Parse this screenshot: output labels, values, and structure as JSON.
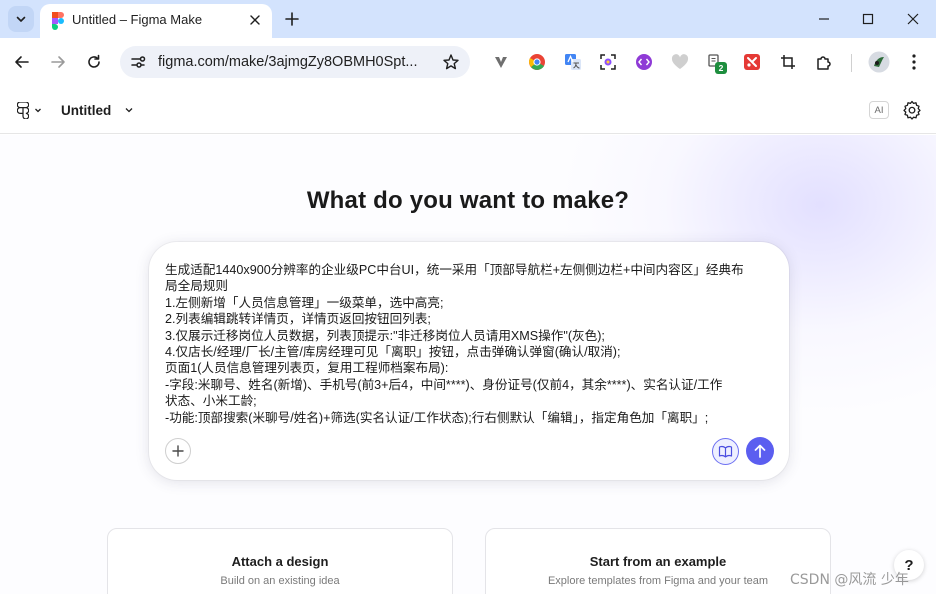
{
  "browser": {
    "tab": {
      "title": "Untitled – Figma Make"
    },
    "url": "figma.com/make/3ajmgZy8OBMH0Spt...",
    "extension_badge": "2"
  },
  "app": {
    "file_name": "Untitled",
    "ai_badge": "AI"
  },
  "main": {
    "heading": "What do you want to make?",
    "prompt_lines": [
      "生成适配1440x900分辨率的企业级PC中台UI，统一采用「顶部导航栏+左侧侧边栏+中间内容区」经典布",
      "局全局规则",
      "1.左侧新增「人员信息管理」一级菜单，选中高亮;",
      "2.列表编辑跳转详情页，详情页返回按钮回列表;",
      "3.仅展示迁移岗位人员数据，列表顶提示:\"非迁移岗位人员请用XMS操作\"(灰色);",
      "4.仅店长/经理/厂长/主管/库房经理可见「离职」按钮，点击弹确认弹窗(确认/取消);",
      "页面1(人员信息管理列表页，复用工程师档案布局):",
      "-字段:米聊号、姓名(新增)、手机号(前3+后4，中间****)、身份证号(仅前4，其余****)、实名认证/工作",
      "状态、小米工龄;",
      "-功能:顶部搜索(米聊号/姓名)+筛选(实名认证/工作状态);行右侧默认「编辑」，指定角色加「离职」;"
    ],
    "options": [
      {
        "title": "Attach a design",
        "subtitle": "Build on an existing idea"
      },
      {
        "title": "Start from an example",
        "subtitle": "Explore templates from Figma and your team"
      }
    ],
    "help_label": "?"
  },
  "watermark": "CSDN @风流 少年",
  "colors": {
    "accent": "#5b5ef0",
    "tabbar": "#d3e3fd",
    "omnibox": "#eef1f8"
  }
}
